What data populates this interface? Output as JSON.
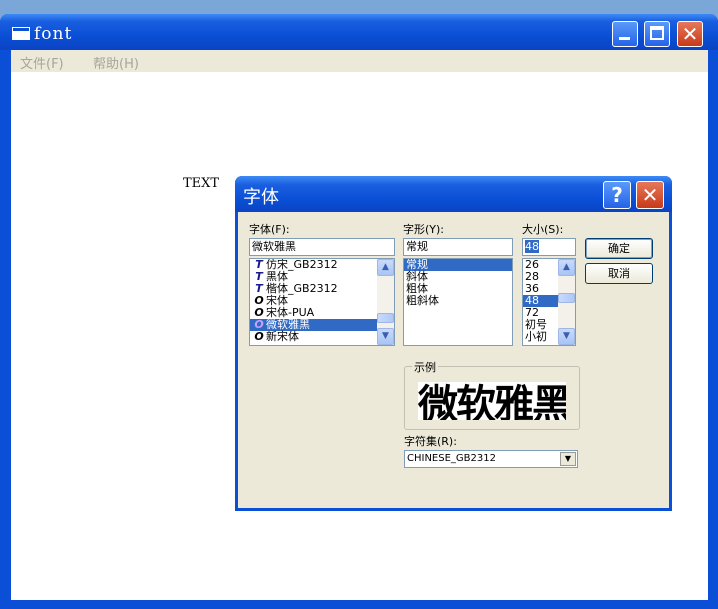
{
  "window": {
    "title": "font",
    "menu": [
      "文件(F)",
      "帮助(H)"
    ]
  },
  "canvas": {
    "text": "TEXT"
  },
  "dialog": {
    "title": "字体",
    "help_glyph": "?",
    "close_glyph": "✕",
    "font_label": "字体(F):",
    "font_value": "微软雅黑",
    "font_list": [
      {
        "icon": "TT",
        "name": "仿宋_GB2312",
        "selected": false
      },
      {
        "icon": "TT",
        "name": "黑体",
        "selected": false
      },
      {
        "icon": "TT",
        "name": "楷体_GB2312",
        "selected": false
      },
      {
        "icon": "O",
        "name": "宋体",
        "selected": false
      },
      {
        "icon": "O",
        "name": "宋体-PUA",
        "selected": false
      },
      {
        "icon": "O",
        "name": "微软雅黑",
        "selected": true
      },
      {
        "icon": "O",
        "name": "新宋体",
        "selected": false
      }
    ],
    "style_label": "字形(Y):",
    "style_value": "常规",
    "style_list": [
      {
        "name": "常规",
        "selected": true
      },
      {
        "name": "斜体",
        "selected": false
      },
      {
        "name": "粗体",
        "selected": false
      },
      {
        "name": "粗斜体",
        "selected": false
      }
    ],
    "size_label": "大小(S):",
    "size_value": "48",
    "size_list": [
      {
        "name": "26",
        "selected": false
      },
      {
        "name": "28",
        "selected": false
      },
      {
        "name": "36",
        "selected": false
      },
      {
        "name": "48",
        "selected": true
      },
      {
        "name": "72",
        "selected": false
      },
      {
        "name": "初号",
        "selected": false
      },
      {
        "name": "小初",
        "selected": false
      }
    ],
    "ok_label": "确定",
    "cancel_label": "取消",
    "sample_label": "示例",
    "sample_text": "微软雅黑",
    "charset_label": "字符集(R):",
    "charset_value": "CHINESE_GB2312",
    "colors": {
      "selection": "#316ac5",
      "titlebar": "#0a4fd6"
    }
  }
}
